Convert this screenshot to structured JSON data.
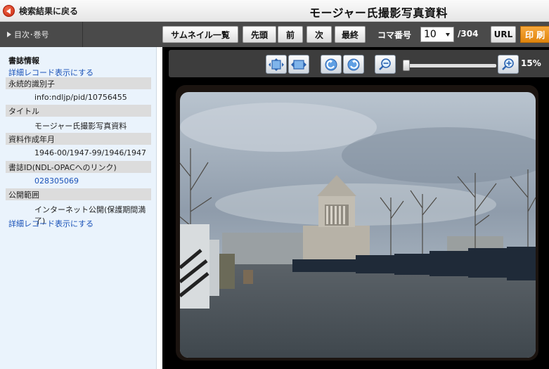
{
  "header": {
    "back_label": "検索結果に戻る",
    "title": "モージャー氏撮影写真資料"
  },
  "toolbar": {
    "toc_label": "目次･巻号",
    "thumbnails_label": "サムネイル一覧",
    "first_label": "先頭",
    "prev_label": "前",
    "next_label": "次",
    "last_label": "最終",
    "frame_label": "コマ番号",
    "frame_value": "10",
    "frame_total": "/304",
    "url_label": "URL",
    "print_label": "印 刷"
  },
  "sidebar": {
    "heading": "書誌情報",
    "detail_link_top": "詳細レコード表示にする",
    "fields": [
      {
        "label": "永続的識別子",
        "value": "info:ndljp/pid/10756455"
      },
      {
        "label": "タイトル",
        "value": "モージャー氏撮影写真資料"
      },
      {
        "label": "資料作成年月",
        "value": "1946-00/1947-99/1946/1947"
      },
      {
        "label": "書誌ID(NDL-OPACへのリンク)",
        "value": "028305069"
      },
      {
        "label": "公開範囲",
        "value": "インターネット公開(保護期間満了)"
      }
    ],
    "detail_link_bottom": "詳細レコード表示にする"
  },
  "viewer": {
    "zoom_level": "15%",
    "zoom_fraction": 0.02
  },
  "colors": {
    "toolbar_bg": "#4a4a4a",
    "sidebar_bg": "#eaf3fc",
    "link": "#1a52b8",
    "print_accent": "#f29b20",
    "back_icon": "#d9331a"
  },
  "icons": [
    "back-arrow-icon",
    "fit-page-icon",
    "fit-width-icon",
    "rotate-left-icon",
    "rotate-right-icon",
    "zoom-out-icon",
    "zoom-in-icon"
  ]
}
